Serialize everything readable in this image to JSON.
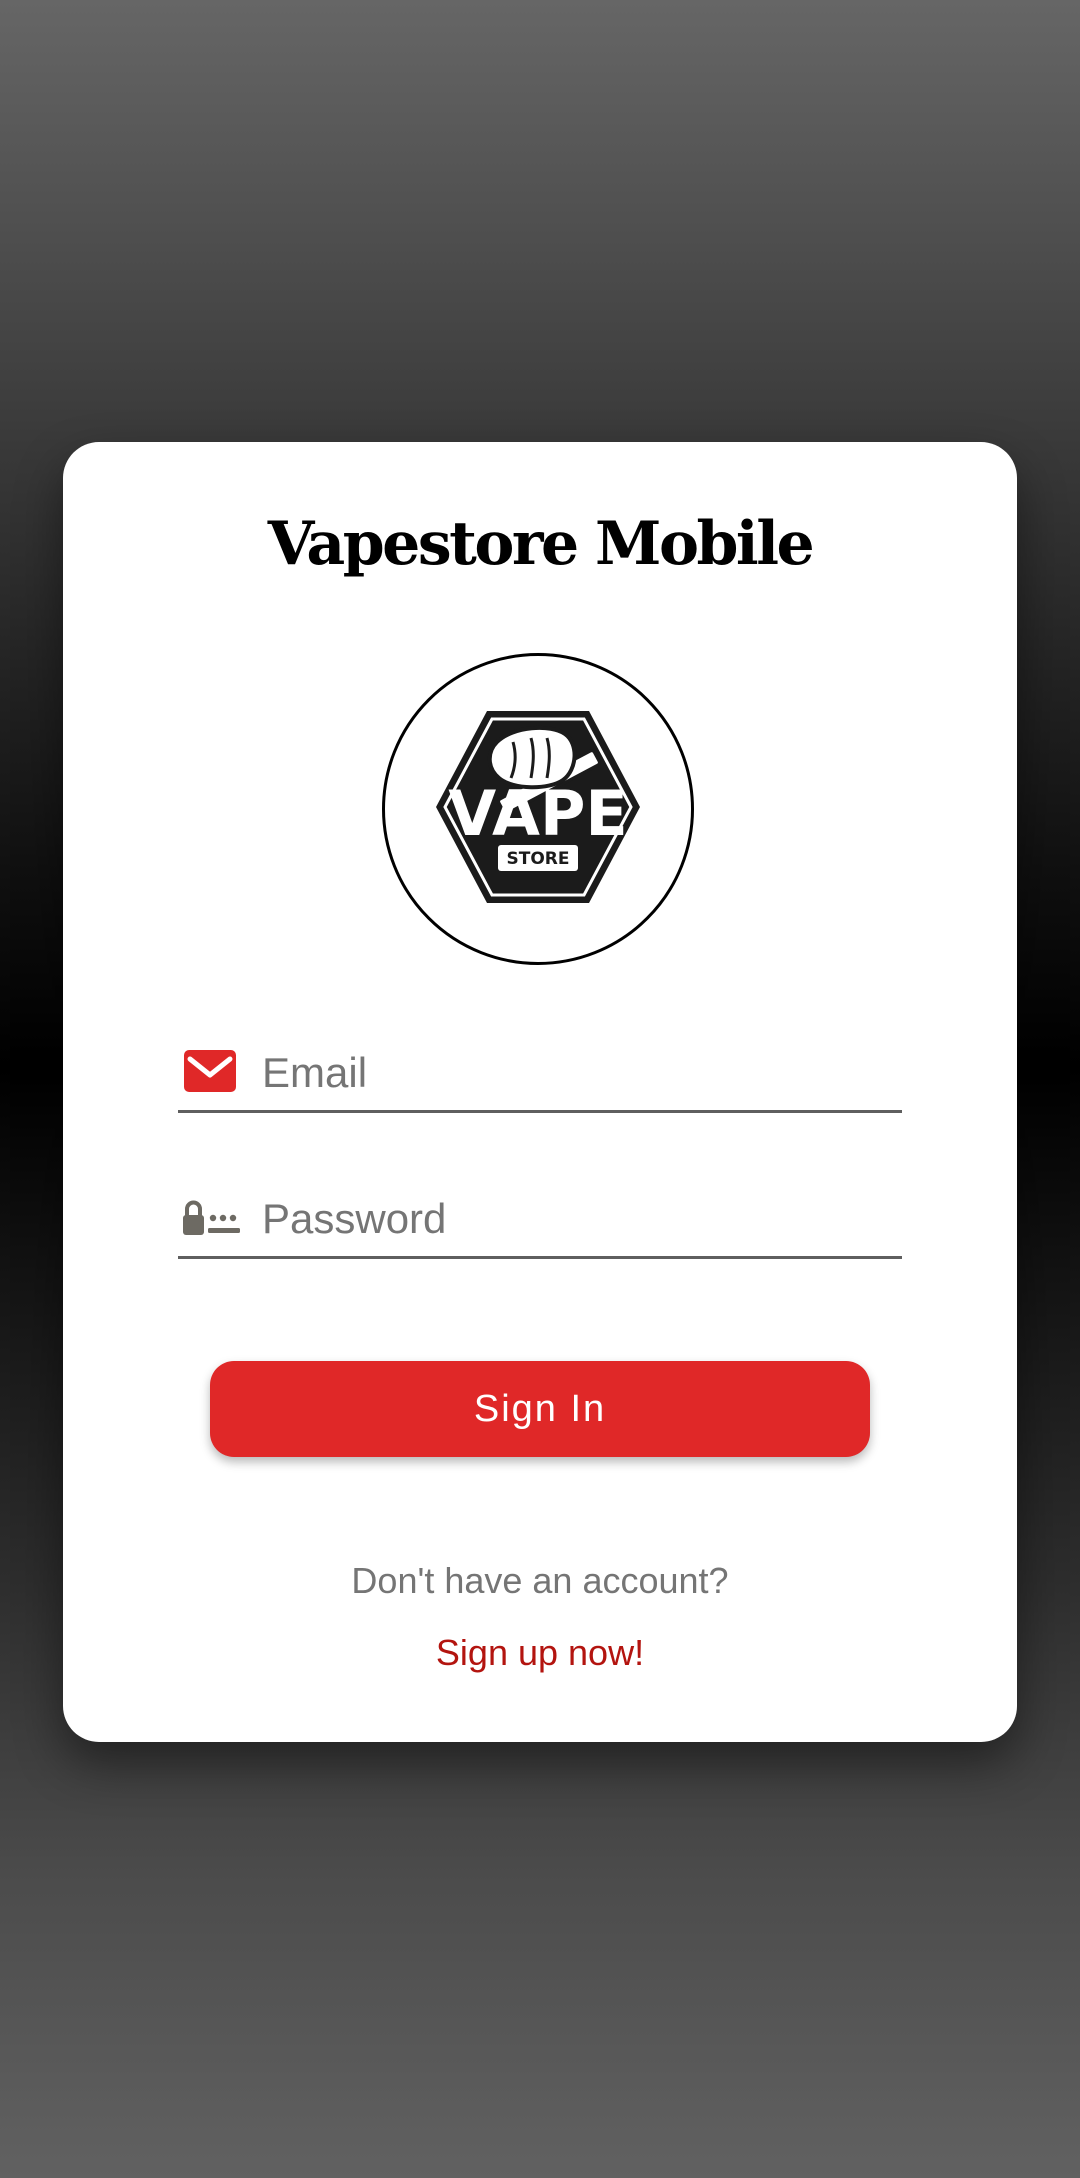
{
  "app": {
    "title": "Vapestore Mobile"
  },
  "logo": {
    "name": "vape-store-logo",
    "text_main": "VAPE",
    "text_sub": "STORE"
  },
  "form": {
    "email_placeholder": "Email",
    "email_value": "",
    "email_icon": "mail-icon",
    "password_placeholder": "Password",
    "password_value": "",
    "password_icon": "password-lock-icon",
    "sign_in_label": "Sign In"
  },
  "footer": {
    "prompt": "Don't have an account?",
    "signup_link": "Sign up now!"
  },
  "colors": {
    "accent": "#e02828",
    "link": "#b3140f",
    "muted_text": "#757575",
    "card_bg": "#ffffff"
  }
}
